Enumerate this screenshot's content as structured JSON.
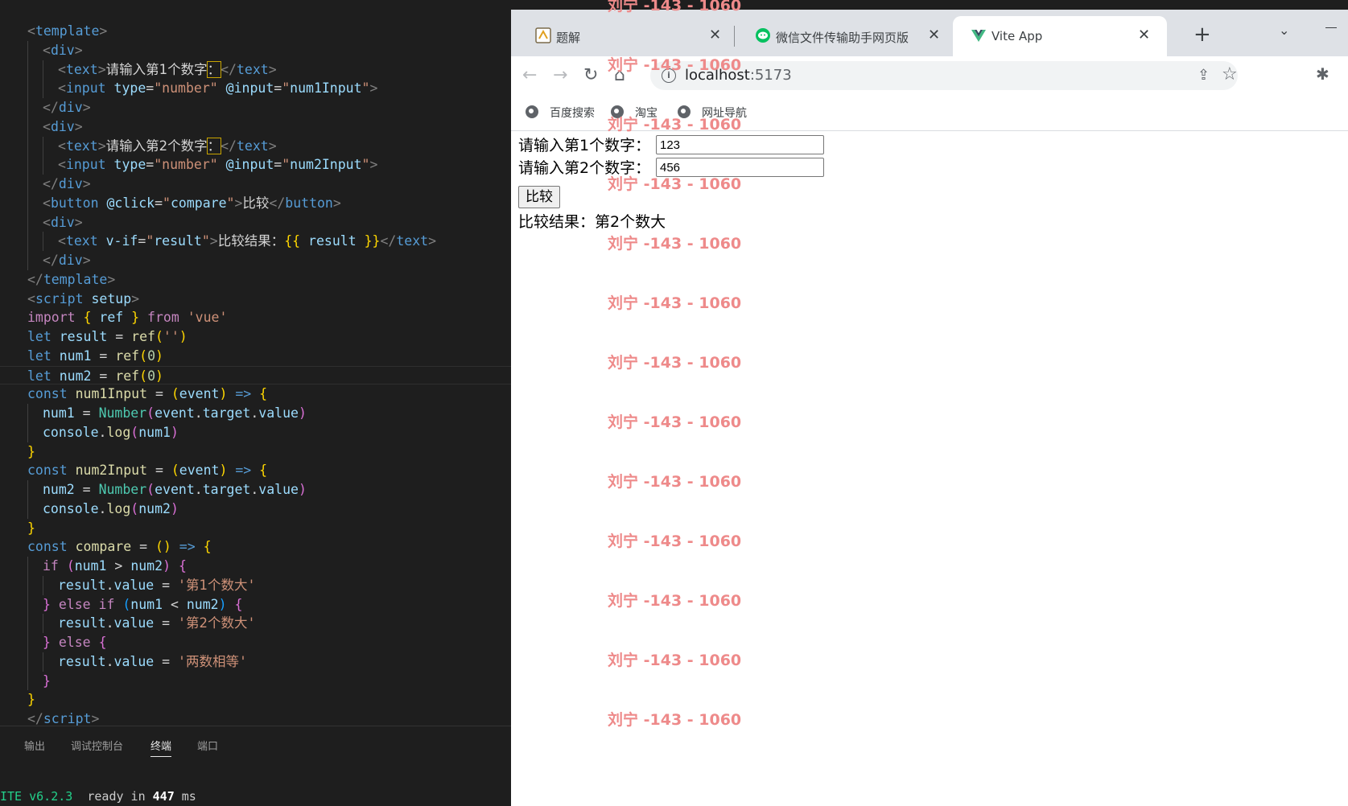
{
  "editor": {
    "lines": [
      {
        "indent": 1,
        "html": "<span class=\"tk-tag\">&lt;</span><span class=\"tk-tname\">template</span><span class=\"tk-tag\">&gt;</span>"
      },
      {
        "indent": 2,
        "html": "<span class=\"tk-tag\">&lt;</span><span class=\"tk-tname\">div</span><span class=\"tk-tag\">&gt;</span>"
      },
      {
        "indent": 3,
        "html": "<span class=\"tk-tag\">&lt;</span><span class=\"tk-tname\">text</span><span class=\"tk-tag\">&gt;</span><span class=\"tk-cjk\">请输入第1个数字</span><span class=\"tk-colon\">：</span><span class=\"tk-tag\">&lt;/</span><span class=\"tk-tname\">text</span><span class=\"tk-tag\">&gt;</span>"
      },
      {
        "indent": 3,
        "html": "<span class=\"tk-tag\">&lt;</span><span class=\"tk-tname\">input</span> <span class=\"tk-attr\">type</span>=<span class=\"tk-str\">\"number\"</span> <span class=\"tk-attr\">@input</span>=<span class=\"tk-str\">\"</span><span class=\"tk-var\">num1Input</span><span class=\"tk-str\">\"</span><span class=\"tk-tag\">&gt;</span>"
      },
      {
        "indent": 2,
        "html": "<span class=\"tk-tag\">&lt;/</span><span class=\"tk-tname\">div</span><span class=\"tk-tag\">&gt;</span>"
      },
      {
        "indent": 2,
        "html": "<span class=\"tk-tag\">&lt;</span><span class=\"tk-tname\">div</span><span class=\"tk-tag\">&gt;</span>"
      },
      {
        "indent": 3,
        "html": "<span class=\"tk-tag\">&lt;</span><span class=\"tk-tname\">text</span><span class=\"tk-tag\">&gt;</span><span class=\"tk-cjk\">请输入第2个数字</span><span class=\"tk-colon\">：</span><span class=\"tk-tag\">&lt;/</span><span class=\"tk-tname\">text</span><span class=\"tk-tag\">&gt;</span>"
      },
      {
        "indent": 3,
        "html": "<span class=\"tk-tag\">&lt;</span><span class=\"tk-tname\">input</span> <span class=\"tk-attr\">type</span>=<span class=\"tk-str\">\"number\"</span> <span class=\"tk-attr\">@input</span>=<span class=\"tk-str\">\"</span><span class=\"tk-var\">num2Input</span><span class=\"tk-str\">\"</span><span class=\"tk-tag\">&gt;</span>"
      },
      {
        "indent": 2,
        "html": "<span class=\"tk-tag\">&lt;/</span><span class=\"tk-tname\">div</span><span class=\"tk-tag\">&gt;</span>"
      },
      {
        "indent": 2,
        "html": "<span class=\"tk-tag\">&lt;</span><span class=\"tk-tname\">button</span> <span class=\"tk-attr\">@click</span>=<span class=\"tk-str\">\"</span><span class=\"tk-var\">compare</span><span class=\"tk-str\">\"</span><span class=\"tk-tag\">&gt;</span><span class=\"tk-cjk\">比较</span><span class=\"tk-tag\">&lt;/</span><span class=\"tk-tname\">button</span><span class=\"tk-tag\">&gt;</span>"
      },
      {
        "indent": 2,
        "html": "<span class=\"tk-tag\">&lt;</span><span class=\"tk-tname\">div</span><span class=\"tk-tag\">&gt;</span>"
      },
      {
        "indent": 3,
        "html": "<span class=\"tk-tag\">&lt;</span><span class=\"tk-tname\">text</span> <span class=\"tk-attr\">v-if</span>=<span class=\"tk-str\">\"</span><span class=\"tk-var\">result</span><span class=\"tk-str\">\"</span><span class=\"tk-tag\">&gt;</span><span class=\"tk-cjk\">比较结果：</span><span class=\"tk-br1\">{{</span> <span class=\"tk-var\">result</span> <span class=\"tk-br1\">}}</span><span class=\"tk-tag\">&lt;/</span><span class=\"tk-tname\">text</span><span class=\"tk-tag\">&gt;</span>"
      },
      {
        "indent": 2,
        "html": "<span class=\"tk-tag\">&lt;/</span><span class=\"tk-tname\">div</span><span class=\"tk-tag\">&gt;</span>"
      },
      {
        "indent": 1,
        "html": "<span class=\"tk-tag\">&lt;/</span><span class=\"tk-tname\">template</span><span class=\"tk-tag\">&gt;</span>"
      },
      {
        "indent": 1,
        "html": "<span class=\"tk-tag\">&lt;</span><span class=\"tk-tname\">script</span> <span class=\"tk-attr\">setup</span><span class=\"tk-tag\">&gt;</span>"
      },
      {
        "indent": 1,
        "html": "<span class=\"tk-kw\">import</span> <span class=\"tk-br1\">{</span> <span class=\"tk-var\">ref</span> <span class=\"tk-br1\">}</span> <span class=\"tk-kw\">from</span> <span class=\"tk-str\">'vue'</span>"
      },
      {
        "indent": 1,
        "html": "<span class=\"tk-kw2\">let</span> <span class=\"tk-var\">result</span> = <span class=\"tk-fn\">ref</span><span class=\"tk-br1\">(</span><span class=\"tk-str\">''</span><span class=\"tk-br1\">)</span>"
      },
      {
        "indent": 1,
        "html": "<span class=\"tk-kw2\">let</span> <span class=\"tk-var\">num1</span> = <span class=\"tk-fn\">ref</span><span class=\"tk-br1\">(</span><span class=\"tk-num\">0</span><span class=\"tk-br1\">)</span>"
      },
      {
        "indent": 1,
        "current": true,
        "html": "<span class=\"tk-kw2\">let</span> <span class=\"tk-var\">num2</span> = <span class=\"tk-fn\">ref</span><span class=\"tk-br1\">(</span><span class=\"tk-num\">0</span><span class=\"tk-br1\">)</span>"
      },
      {
        "indent": 1,
        "html": "<span class=\"tk-kw2\">const</span> <span class=\"tk-fn\">num1Input</span> = <span class=\"tk-br1\">(</span><span class=\"tk-var\">event</span><span class=\"tk-br1\">)</span> <span class=\"tk-kw2\">=&gt;</span> <span class=\"tk-br1\">{</span>"
      },
      {
        "indent": 2,
        "html": "<span class=\"tk-var\">num1</span> = <span class=\"tk-type\">Number</span><span class=\"tk-br2\">(</span><span class=\"tk-var\">event</span>.<span class=\"tk-var\">target</span>.<span class=\"tk-var\">value</span><span class=\"tk-br2\">)</span>"
      },
      {
        "indent": 2,
        "html": "<span class=\"tk-var\">console</span>.<span class=\"tk-fn\">log</span><span class=\"tk-br2\">(</span><span class=\"tk-var\">num1</span><span class=\"tk-br2\">)</span>"
      },
      {
        "indent": 1,
        "html": "<span class=\"tk-br1\">}</span>"
      },
      {
        "indent": 1,
        "html": "<span class=\"tk-kw2\">const</span> <span class=\"tk-fn\">num2Input</span> = <span class=\"tk-br1\">(</span><span class=\"tk-var\">event</span><span class=\"tk-br1\">)</span> <span class=\"tk-kw2\">=&gt;</span> <span class=\"tk-br1\">{</span>"
      },
      {
        "indent": 2,
        "html": "<span class=\"tk-var\">num2</span> = <span class=\"tk-type\">Number</span><span class=\"tk-br2\">(</span><span class=\"tk-var\">event</span>.<span class=\"tk-var\">target</span>.<span class=\"tk-var\">value</span><span class=\"tk-br2\">)</span>"
      },
      {
        "indent": 2,
        "html": "<span class=\"tk-var\">console</span>.<span class=\"tk-fn\">log</span><span class=\"tk-br2\">(</span><span class=\"tk-var\">num2</span><span class=\"tk-br2\">)</span>"
      },
      {
        "indent": 1,
        "html": "<span class=\"tk-br1\">}</span>"
      },
      {
        "indent": 1,
        "html": "<span class=\"tk-kw2\">const</span> <span class=\"tk-fn\">compare</span> = <span class=\"tk-br1\">()</span> <span class=\"tk-kw2\">=&gt;</span> <span class=\"tk-br1\">{</span>"
      },
      {
        "indent": 2,
        "html": "<span class=\"tk-kw\">if</span> <span class=\"tk-br2\">(</span><span class=\"tk-var\">num1</span> &gt; <span class=\"tk-var\">num2</span><span class=\"tk-br2\">)</span> <span class=\"tk-br2\">{</span>"
      },
      {
        "indent": 3,
        "html": "<span class=\"tk-var\">result</span>.<span class=\"tk-var\">value</span> = <span class=\"tk-str\">'<span class=\"tk-cjk\">第1个数大</span>'</span>"
      },
      {
        "indent": 2,
        "html": "<span class=\"tk-br2\">}</span> <span class=\"tk-kw\">else if</span> <span class=\"tk-br3\">(</span><span class=\"tk-var\">num1</span> &lt; <span class=\"tk-var\">num2</span><span class=\"tk-br3\">)</span> <span class=\"tk-br2\">{</span>"
      },
      {
        "indent": 3,
        "html": "<span class=\"tk-var\">result</span>.<span class=\"tk-var\">value</span> = <span class=\"tk-str\">'<span class=\"tk-cjk\">第2个数大</span>'</span>"
      },
      {
        "indent": 2,
        "html": "<span class=\"tk-br2\">}</span> <span class=\"tk-kw\">else</span> <span class=\"tk-br2\">{</span>"
      },
      {
        "indent": 3,
        "html": "<span class=\"tk-var\">result</span>.<span class=\"tk-var\">value</span> = <span class=\"tk-str\">'<span class=\"tk-cjk\">两数相等</span>'</span>"
      },
      {
        "indent": 2,
        "html": "<span class=\"tk-br2\">}</span>"
      },
      {
        "indent": 1,
        "html": "<span class=\"tk-br1\">}</span>"
      },
      {
        "indent": 1,
        "html": "<span class=\"tk-tag\">&lt;/</span><span class=\"tk-tname\">script</span><span class=\"tk-tag\">&gt;</span>"
      }
    ]
  },
  "panel": {
    "tabs": [
      "输出",
      "调试控制台",
      "终端",
      "端口"
    ],
    "active_tab": "终端",
    "terminal": {
      "prefix": "ITE v6.2.3",
      "ready": "ready in",
      "ms_value": "447",
      "ms": "ms"
    }
  },
  "browser": {
    "tabs": [
      {
        "title": "题解",
        "icon": "leetcode-icon",
        "active": false
      },
      {
        "title": "微信文件传输助手网页版",
        "icon": "wechat-icon",
        "active": false
      },
      {
        "title": "Vite App",
        "icon": "vue-icon",
        "active": true
      }
    ],
    "url_host": "localhost",
    "url_port": ":5173",
    "bookmarks": [
      "百度搜索",
      "淘宝",
      "网址导航"
    ]
  },
  "page": {
    "label1": "请输入第1个数字：",
    "value1": "123",
    "label2": "请输入第2个数字：",
    "value2": "456",
    "button": "比较",
    "result": "比较结果：第2个数大"
  },
  "watermark": "刘宁 -143 - 1060",
  "watermark_color": "#ee8a8a"
}
